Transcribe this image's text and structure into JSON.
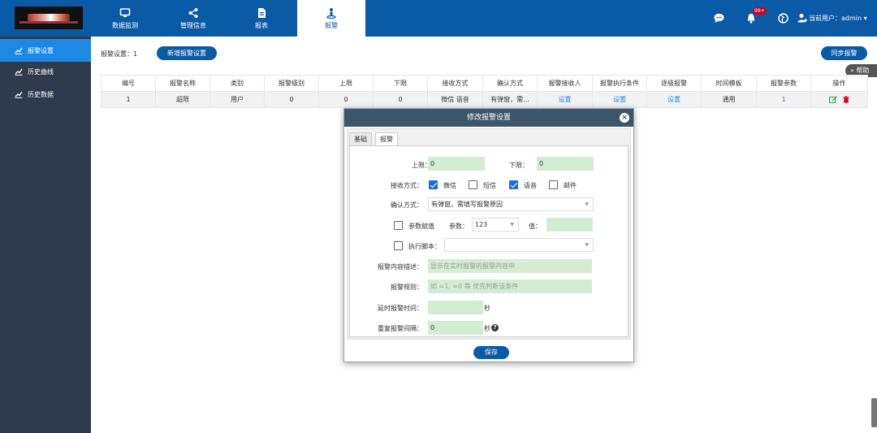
{
  "nav": {
    "tabs": [
      {
        "label": "数据监测",
        "icon": "monitor-icon"
      },
      {
        "label": "管理信息",
        "icon": "share-icon"
      },
      {
        "label": "报表",
        "icon": "document-icon"
      },
      {
        "label": "报警",
        "icon": "alarm-person-icon"
      }
    ],
    "active_tab": "报警",
    "notification_badge": "99+",
    "user_label": "当前用户：admin ▾"
  },
  "sidebar": {
    "items": [
      {
        "label": "报警设置",
        "icon": "chart-line-icon",
        "active": true
      },
      {
        "label": "历史曲线",
        "icon": "chart-line-icon",
        "active": false
      },
      {
        "label": "历史数据",
        "icon": "chart-line-icon",
        "active": false
      }
    ]
  },
  "main": {
    "settings_count_label": "报警设置：1",
    "add_button": "新增报警设置",
    "sync_button": "同步报警",
    "help_tab": "帮助",
    "table": {
      "headers": [
        "编号",
        "报警名称",
        "类别",
        "报警级别",
        "上限",
        "下限",
        "接收方式",
        "确认方式",
        "报警接收人",
        "报警执行条件",
        "逐级报警",
        "时间模板",
        "报警参数",
        "操作"
      ],
      "rows": [
        [
          "1",
          "超限",
          "用户",
          "0",
          "0",
          "0",
          "微信 语音",
          "有弹窗，需...",
          "设置",
          "设置",
          "设置",
          "通用",
          "1",
          ""
        ]
      ]
    }
  },
  "dialog": {
    "title": "修改报警设置",
    "tabs": [
      "基础",
      "报警"
    ],
    "active_tab": "报警",
    "upper_label": "上限：",
    "upper_value": "0",
    "lower_label": "下限：",
    "lower_value": "0",
    "receive_label": "接收方式：",
    "receive_options": [
      {
        "label": "微信",
        "checked": true
      },
      {
        "label": "短信",
        "checked": false
      },
      {
        "label": "语音",
        "checked": true
      },
      {
        "label": "邮件",
        "checked": false
      }
    ],
    "confirm_label": "确认方式：",
    "confirm_value": "有弹窗，需填写报警原因",
    "param_assign_label": "参数赋值",
    "param_label": "参数：",
    "param_value": "123",
    "value_label": "值：",
    "exec_script_label": "执行脚本：",
    "content_desc_label": "报警内容描述：",
    "content_desc_placeholder": "显示在实时报警的报警内容中",
    "rule_label": "报警规则：",
    "rule_placeholder": "如 =1, =0 等 优先判断该条件",
    "delay_label": "延时报警时间：",
    "delay_unit": "秒",
    "repeat_label": "重复报警间隔：",
    "repeat_value": "0",
    "repeat_unit": "秒",
    "save_button": "保存"
  }
}
